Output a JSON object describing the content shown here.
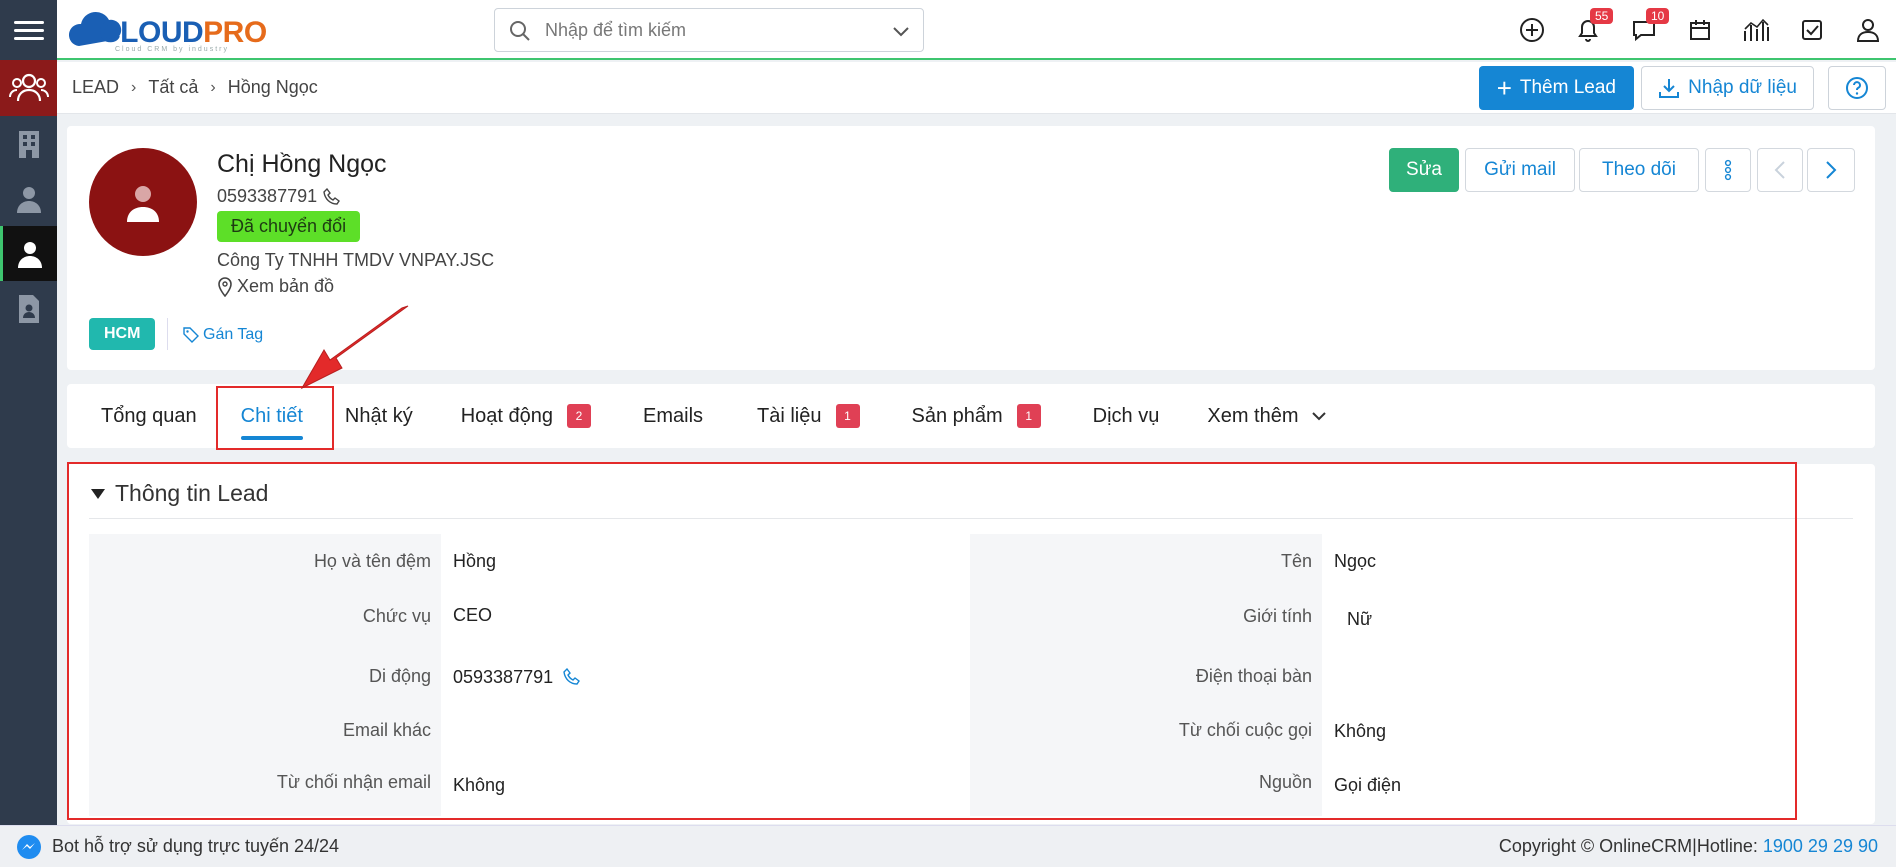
{
  "app": {
    "logo_main": "CLOUD",
    "logo_accent": "PRO",
    "logo_sub": "Cloud CRM by industry"
  },
  "search": {
    "placeholder": "Nhập để tìm kiếm"
  },
  "top_icons": [
    {
      "name": "add-icon",
      "badge": ""
    },
    {
      "name": "bell-icon",
      "badge": "55"
    },
    {
      "name": "chat-icon",
      "badge": "10"
    },
    {
      "name": "calendar-icon",
      "badge": ""
    },
    {
      "name": "chart-icon",
      "badge": ""
    },
    {
      "name": "task-icon",
      "badge": ""
    },
    {
      "name": "user-icon",
      "badge": ""
    }
  ],
  "breadcrumb": {
    "root": "LEAD",
    "level1": "Tất cả",
    "level2": "Hồng Ngọc"
  },
  "header_buttons": {
    "add_lead": "Thêm Lead",
    "import": "Nhập dữ liệu"
  },
  "lead": {
    "name": "Chị Hồng Ngọc",
    "phone": "0593387791",
    "status": "Đã chuyển đổi",
    "company": "Công Ty TNHH TMDV VNPAY.JSC",
    "map": "Xem bản đồ",
    "tag": "HCM",
    "assign_tag": "Gán Tag"
  },
  "actions": {
    "edit": "Sửa",
    "send_mail": "Gửi mail",
    "follow": "Theo dõi"
  },
  "tabs": [
    {
      "label": "Tổng quan",
      "count": ""
    },
    {
      "label": "Chi tiết",
      "count": ""
    },
    {
      "label": "Nhật ký",
      "count": ""
    },
    {
      "label": "Hoạt động",
      "count": "2"
    },
    {
      "label": "Emails",
      "count": ""
    },
    {
      "label": "Tài liệu",
      "count": "1"
    },
    {
      "label": "Sản phẩm",
      "count": "1"
    },
    {
      "label": "Dịch vụ",
      "count": ""
    },
    {
      "label": "Xem thêm",
      "count": ""
    }
  ],
  "section": {
    "title": "Thông tin Lead"
  },
  "fields": {
    "ho_ten_dem": {
      "label": "Họ và tên đệm",
      "value": "Hồng"
    },
    "ten": {
      "label": "Tên",
      "value": "Ngọc"
    },
    "chuc_vu": {
      "label": "Chức vụ",
      "value": "CEO"
    },
    "gioi_tinh": {
      "label": "Giới tính",
      "value": "Nữ"
    },
    "di_dong": {
      "label": "Di động",
      "value": "0593387791"
    },
    "dien_thoai_ban": {
      "label": "Điện thoại bàn",
      "value": ""
    },
    "email_khac": {
      "label": "Email khác",
      "value": ""
    },
    "tu_choi_cuoc_goi": {
      "label": "Từ chối cuộc gọi",
      "value": "Không"
    },
    "tu_choi_email": {
      "label": "Từ chối nhận email",
      "value": "Không"
    },
    "nguon": {
      "label": "Nguồn",
      "value": "Gọi điện"
    }
  },
  "footer": {
    "bot": "Bot hỗ trợ sử dụng trực tuyến 24/24",
    "copyright": "Copyright © OnlineCRM|Hotline: ",
    "hotline": "1900 29 29 90"
  },
  "colors": {
    "accent": "#1586d4",
    "green": "#2fb07a",
    "status": "#5ddf28",
    "highlight": "#e32a2a"
  }
}
